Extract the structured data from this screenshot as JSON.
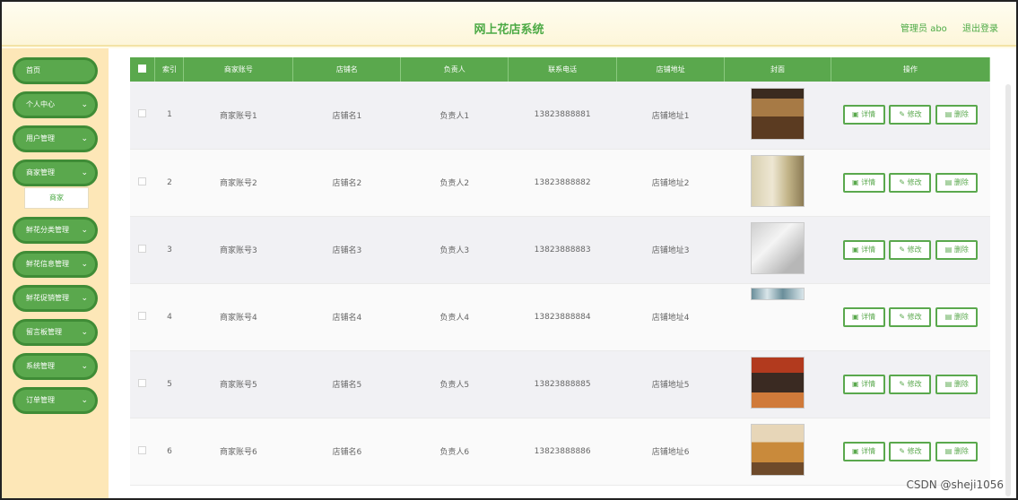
{
  "header": {
    "title": "网上花店系统",
    "user_label": "管理员 abo",
    "logout": "退出登录"
  },
  "sidebar": {
    "items": [
      {
        "label": "首页",
        "chevron": ""
      },
      {
        "label": "个人中心",
        "chevron": "⌄"
      },
      {
        "label": "用户管理",
        "chevron": "⌄"
      },
      {
        "label": "商家管理",
        "chevron": "⌄"
      },
      {
        "label": "鲜花分类管理",
        "chevron": "⌄"
      },
      {
        "label": "鲜花信息管理",
        "chevron": "⌄"
      },
      {
        "label": "鲜花促销管理",
        "chevron": "⌄"
      },
      {
        "label": "留言板管理",
        "chevron": "⌄"
      },
      {
        "label": "系统管理",
        "chevron": "⌄"
      },
      {
        "label": "订单管理",
        "chevron": "⌄"
      }
    ],
    "submenu": "商家"
  },
  "table": {
    "headers": [
      "",
      "索引",
      "商家账号",
      "店铺名",
      "负责人",
      "联系电话",
      "店铺地址",
      "封面",
      "操作"
    ],
    "rows": [
      {
        "index": "1",
        "account": "商家账号1",
        "shop": "店铺名1",
        "owner": "负责人1",
        "phone": "13823888881",
        "address": "店铺地址1"
      },
      {
        "index": "2",
        "account": "商家账号2",
        "shop": "店铺名2",
        "owner": "负责人2",
        "phone": "13823888882",
        "address": "店铺地址2"
      },
      {
        "index": "3",
        "account": "商家账号3",
        "shop": "店铺名3",
        "owner": "负责人3",
        "phone": "13823888883",
        "address": "店铺地址3"
      },
      {
        "index": "4",
        "account": "商家账号4",
        "shop": "店铺名4",
        "owner": "负责人4",
        "phone": "13823888884",
        "address": "店铺地址4"
      },
      {
        "index": "5",
        "account": "商家账号5",
        "shop": "店铺名5",
        "owner": "负责人5",
        "phone": "13823888885",
        "address": "店铺地址5"
      },
      {
        "index": "6",
        "account": "商家账号6",
        "shop": "店铺名6",
        "owner": "负责人6",
        "phone": "13823888886",
        "address": "店铺地址6"
      }
    ],
    "buttons": {
      "detail": "详情",
      "edit": "修改",
      "delete": "删除"
    }
  },
  "watermark": "CSDN @sheji1056",
  "colors": {
    "accent": "#5aa84d",
    "sidebar_bg": "#fde7b7",
    "header_bg": "#fdf6da"
  }
}
